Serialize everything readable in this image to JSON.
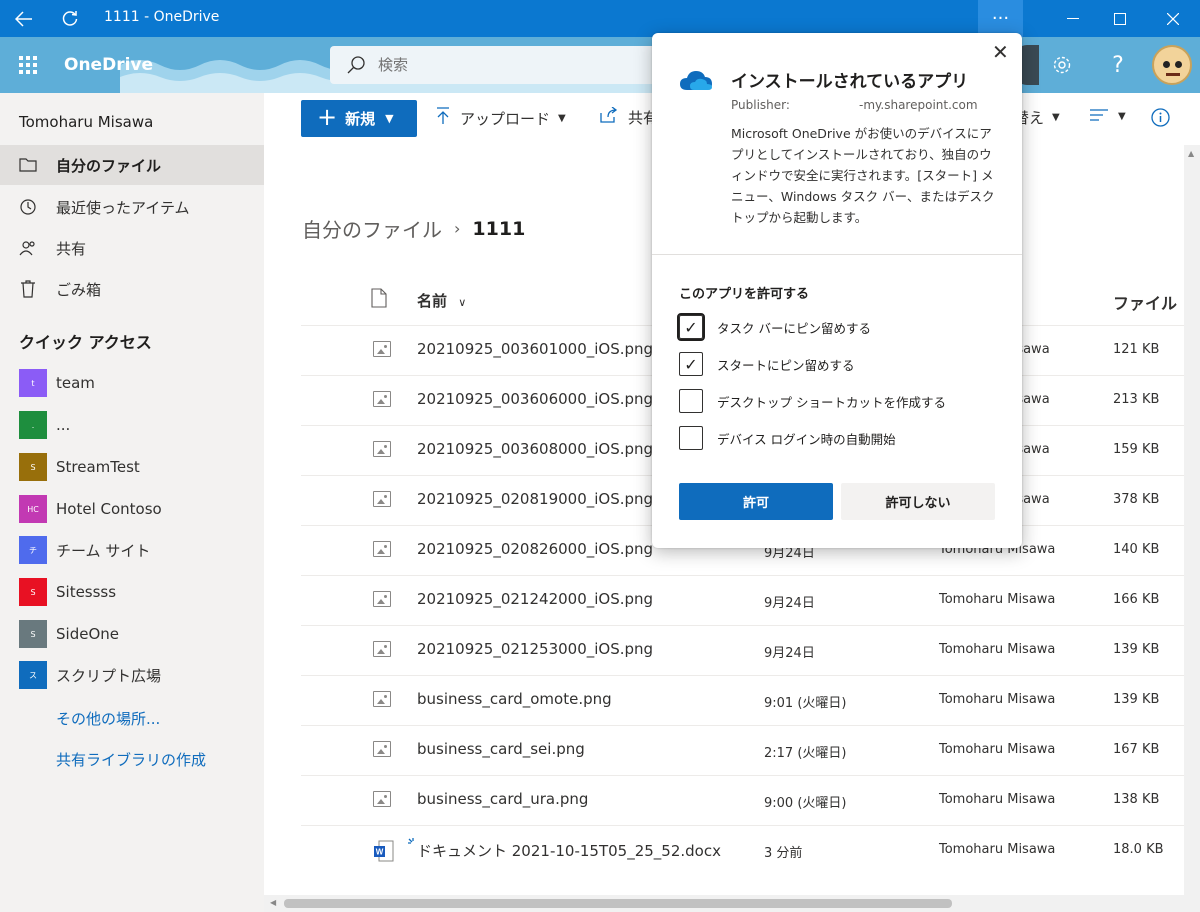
{
  "window": {
    "title": "1111 - OneDrive",
    "more_label": "···"
  },
  "suite": {
    "app_name": "OneDrive",
    "search_placeholder": "検索"
  },
  "leftnav": {
    "user_name": "Tomoharu Misawa",
    "items": [
      {
        "label": "自分のファイル",
        "icon": "folder-icon",
        "selected": true
      },
      {
        "label": "最近使ったアイテム",
        "icon": "history-icon",
        "selected": false
      },
      {
        "label": "共有",
        "icon": "people-icon",
        "selected": false
      },
      {
        "label": "ごみ箱",
        "icon": "trash-icon",
        "selected": false
      }
    ],
    "quick_access_title": "クイック アクセス",
    "sites": [
      {
        "label": "team",
        "abbr": "t",
        "color": "#8b5cf6"
      },
      {
        "label": "...",
        "abbr": ".",
        "color": "#1e8e3e"
      },
      {
        "label": "StreamTest",
        "abbr": "S",
        "color": "#986f0b"
      },
      {
        "label": "Hotel Contoso",
        "abbr": "HC",
        "color": "#c239b3"
      },
      {
        "label": "チーム サイト",
        "abbr": "チ",
        "color": "#4f6bed"
      },
      {
        "label": "Sitessss",
        "abbr": "S",
        "color": "#e81123"
      },
      {
        "label": "SideOne",
        "abbr": "S",
        "color": "#69797e"
      },
      {
        "label": "スクリプト広場",
        "abbr": "ス",
        "color": "#0f6cbd"
      }
    ],
    "more_places": "その他の場所...",
    "create_library": "共有ライブラリの作成"
  },
  "commandbar": {
    "new_label": "新規",
    "upload_label": "アップロード",
    "share_label": "共有",
    "sort_label": "替え"
  },
  "breadcrumb": {
    "parent": "自分のファイル",
    "separator": "›",
    "current": "1111"
  },
  "table": {
    "headers": {
      "name": "名前",
      "size": "ファイル"
    },
    "rows": [
      {
        "name": "20210925_003601000_iOS.png",
        "modified": "",
        "by": "omoharu Misawa",
        "size": "121 KB",
        "type": "image"
      },
      {
        "name": "20210925_003606000_iOS.png",
        "modified": "",
        "by": "omoharu Misawa",
        "size": "213 KB",
        "type": "image"
      },
      {
        "name": "20210925_003608000_iOS.png",
        "modified": "",
        "by": "omoharu Misawa",
        "size": "159 KB",
        "type": "image"
      },
      {
        "name": "20210925_020819000_iOS.png",
        "modified": "",
        "by": "omoharu Misawa",
        "size": "378 KB",
        "type": "image"
      },
      {
        "name": "20210925_020826000_iOS.png",
        "modified": "9月24日",
        "by": "Tomoharu Misawa",
        "size": "140 KB",
        "type": "image"
      },
      {
        "name": "20210925_021242000_iOS.png",
        "modified": "9月24日",
        "by": "Tomoharu Misawa",
        "size": "166 KB",
        "type": "image"
      },
      {
        "name": "20210925_021253000_iOS.png",
        "modified": "9月24日",
        "by": "Tomoharu Misawa",
        "size": "139 KB",
        "type": "image"
      },
      {
        "name": "business_card_omote.png",
        "modified": "9:01 (火曜日)",
        "by": "Tomoharu Misawa",
        "size": "139 KB",
        "type": "image"
      },
      {
        "name": "business_card_sei.png",
        "modified": "2:17 (火曜日)",
        "by": "Tomoharu Misawa",
        "size": "167 KB",
        "type": "image"
      },
      {
        "name": "business_card_ura.png",
        "modified": "9:00 (火曜日)",
        "by": "Tomoharu Misawa",
        "size": "138 KB",
        "type": "image"
      },
      {
        "name": "ドキュメント 2021-10-15T05_25_52.docx",
        "modified": "3 分前",
        "by": "Tomoharu Misawa",
        "size": "18.0 KB",
        "type": "word"
      }
    ]
  },
  "dialog": {
    "title": "インストールされているアプリ",
    "publisher_label": "Publisher:",
    "publisher_host": "-my.sharepoint.com",
    "description": "Microsoft OneDrive がお使いのデバイスにアプリとしてインストールされており、独自のウィンドウで安全に実行されます。[スタート] メニュー、Windows タスク バー、またはデスクトップから起動します。",
    "permissions_title": "このアプリを許可する",
    "options": [
      {
        "label": "タスク バーにピン留めする",
        "checked": true
      },
      {
        "label": "スタートにピン留めする",
        "checked": true
      },
      {
        "label": "デスクトップ ショートカットを作成する",
        "checked": false
      },
      {
        "label": "デバイス ログイン時の自動開始",
        "checked": false
      }
    ],
    "allow_label": "許可",
    "deny_label": "許可しない"
  },
  "colors": {
    "accent": "#0f6cbd",
    "titlebar": "#0b78d0",
    "suite": "#5eaed8"
  }
}
